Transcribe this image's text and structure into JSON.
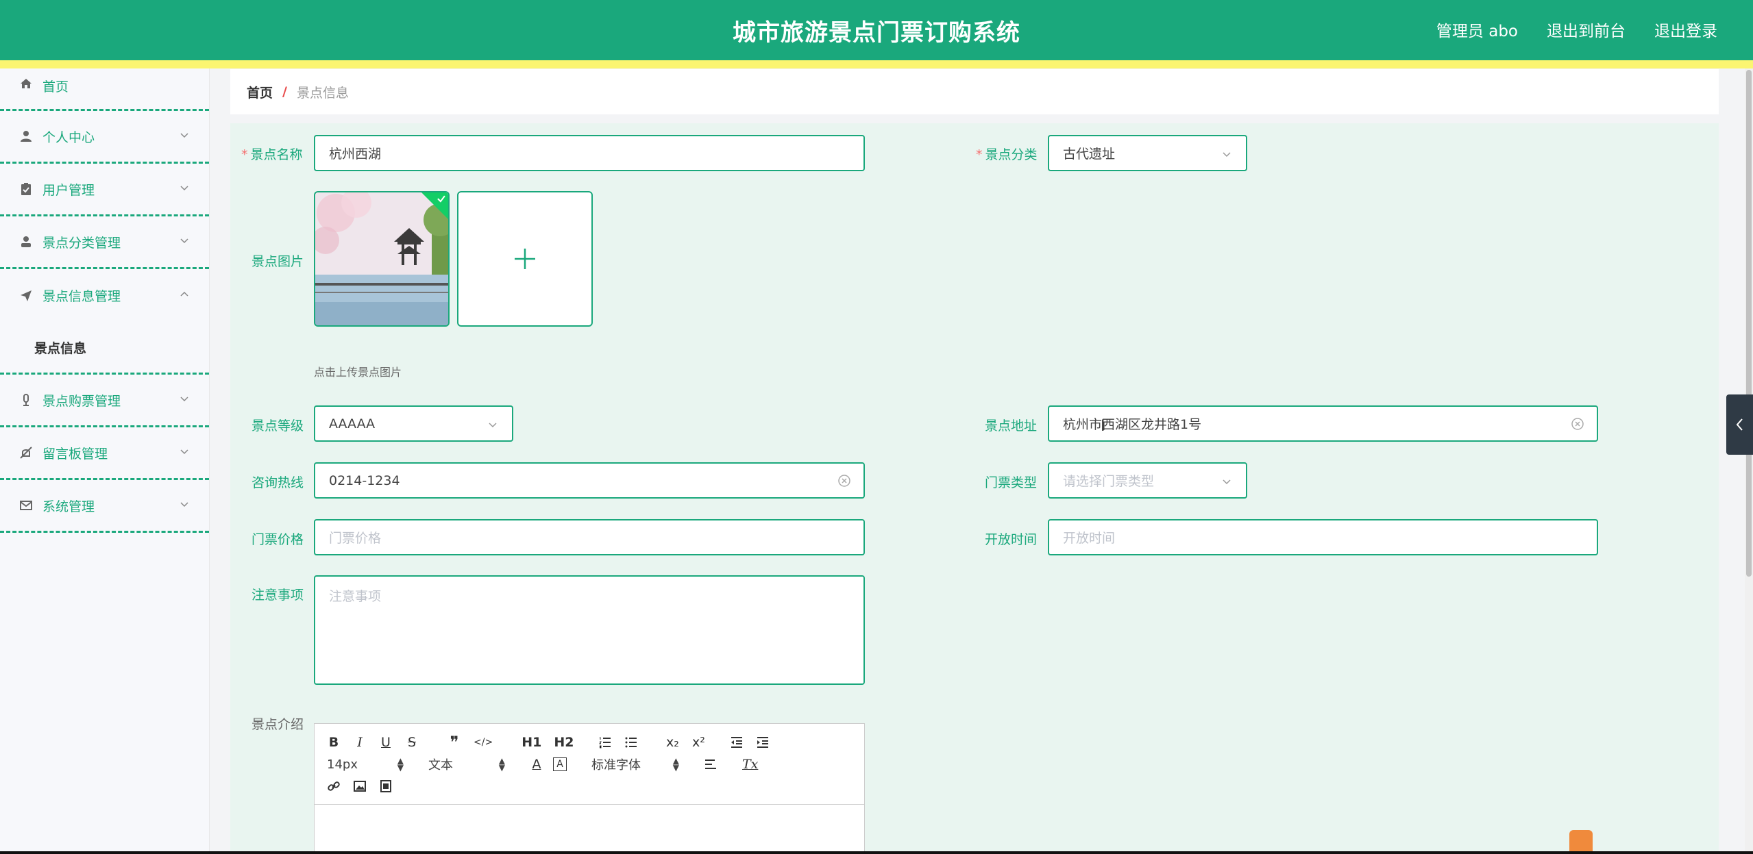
{
  "header": {
    "title": "城市旅游景点门票订购系统",
    "admin_label": "管理员 abo",
    "front_link": "退出到前台",
    "logout_link": "退出登录"
  },
  "sidebar": {
    "items": [
      {
        "label": "首页",
        "icon": "home-icon"
      },
      {
        "label": "个人中心",
        "icon": "user-icon"
      },
      {
        "label": "用户管理",
        "icon": "clipboard-icon"
      },
      {
        "label": "景点分类管理",
        "icon": "person-icon"
      },
      {
        "label": "景点信息管理",
        "icon": "send-icon",
        "expanded": true,
        "children": [
          {
            "label": "景点信息"
          }
        ]
      },
      {
        "label": "景点购票管理",
        "icon": "microphone-icon"
      },
      {
        "label": "留言板管理",
        "icon": "bell-off-icon"
      },
      {
        "label": "系统管理",
        "icon": "mail-icon"
      }
    ]
  },
  "breadcrumb": {
    "home": "首页",
    "separator": "/",
    "current": "景点信息"
  },
  "form": {
    "name": {
      "label": "景点名称",
      "value": "杭州西湖"
    },
    "category": {
      "label": "景点分类",
      "value": "古代遗址"
    },
    "image": {
      "label": "景点图片",
      "tip": "点击上传景点图片"
    },
    "level": {
      "label": "景点等级",
      "value": "AAAAA"
    },
    "address": {
      "label": "景点地址",
      "value": "杭州市西湖区龙井路1号"
    },
    "hotline": {
      "label": "咨询热线",
      "value": "0214-1234"
    },
    "ticket_type": {
      "label": "门票类型",
      "placeholder": "请选择门票类型"
    },
    "price": {
      "label": "门票价格",
      "placeholder": "门票价格"
    },
    "open_time": {
      "label": "开放时间",
      "placeholder": "开放时间"
    },
    "notice": {
      "label": "注意事项",
      "placeholder": "注意事项"
    },
    "intro": {
      "label": "景点介绍"
    }
  },
  "editor": {
    "row1": [
      "B",
      "I",
      "U",
      "S",
      "❞",
      "</>",
      "H1",
      "H2",
      "ol",
      "ul",
      "x₂",
      "x²",
      "outdent",
      "indent"
    ],
    "font_size": "14px",
    "header_select": "文本",
    "font_color": "A",
    "bg_color": "A",
    "font_family": "标准字体",
    "align": "align",
    "clear": "Tx"
  },
  "colors": {
    "primary": "#1aa87c",
    "stripe": "#fbf571",
    "required": "#f56c6c"
  }
}
